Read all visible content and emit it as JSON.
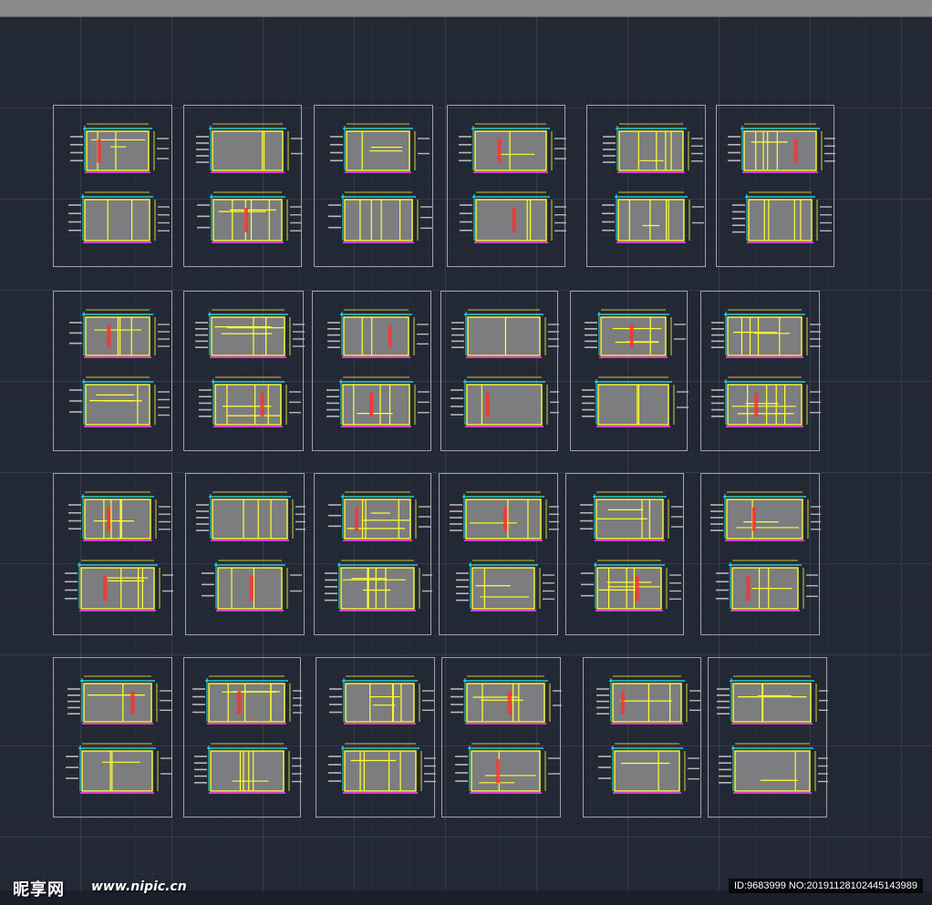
{
  "colors": {
    "frame": "#9da2ab",
    "yellow": "#ffff33",
    "cyan": "#33e6f0",
    "magenta": "#d040d0",
    "red": "#ff3030",
    "gray_fill": "#8c8c8c",
    "annotation": "#b8b8b8",
    "background": "#232835"
  },
  "watermark": {
    "logo": "昵享网",
    "url": "www.nipic.cn",
    "image_id": "ID:9683999 NO:20191128102445143989"
  }
}
